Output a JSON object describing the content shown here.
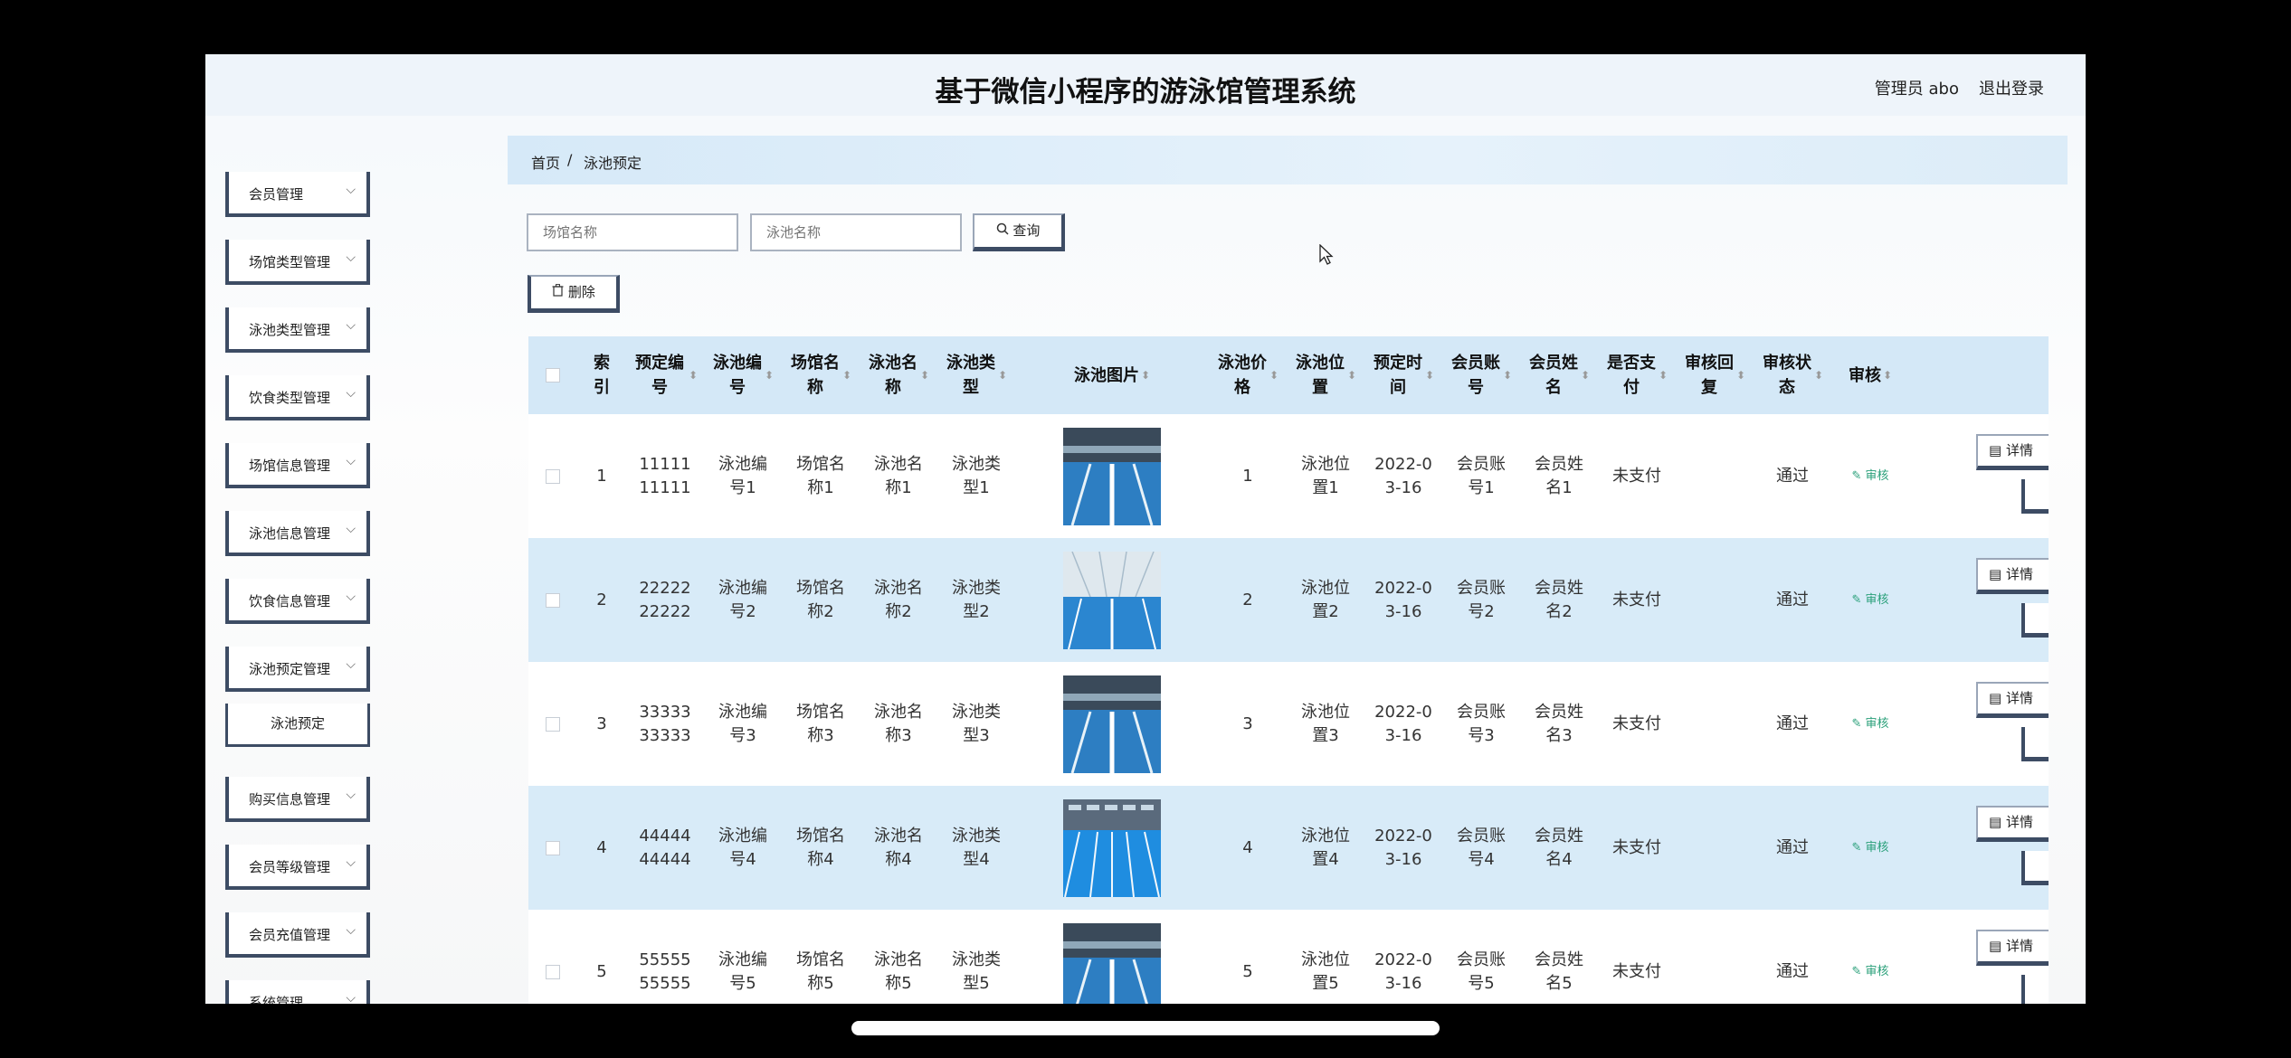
{
  "header": {
    "title": "基于微信小程序的游泳馆管理系统",
    "admin": "管理员 abo",
    "logout": "退出登录"
  },
  "sidebar": {
    "items": [
      {
        "label": "会员管理"
      },
      {
        "label": "场馆类型管理"
      },
      {
        "label": "泳池类型管理"
      },
      {
        "label": "饮食类型管理"
      },
      {
        "label": "场馆信息管理"
      },
      {
        "label": "泳池信息管理"
      },
      {
        "label": "饮食信息管理"
      },
      {
        "label": "泳池预定管理"
      },
      {
        "label": "购买信息管理"
      },
      {
        "label": "会员等级管理"
      },
      {
        "label": "会员充值管理"
      },
      {
        "label": "系统管理"
      }
    ],
    "subitem": {
      "label": "泳池预定"
    }
  },
  "breadcrumb": {
    "home": "首页",
    "sep": "/",
    "current": "泳池预定"
  },
  "search": {
    "venue_placeholder": "场馆名称",
    "pool_placeholder": "泳池名称",
    "query_label": "查询"
  },
  "toolbar": {
    "delete_label": "删除"
  },
  "table": {
    "headers": {
      "index": "索引",
      "booking_no": "预定编号",
      "pool_no": "泳池编号",
      "venue_name": "场馆名称",
      "pool_name": "泳池名称",
      "pool_type": "泳池类型",
      "pool_image": "泳池图片",
      "price": "泳池价格",
      "location": "泳池位置",
      "booking_time": "预定时间",
      "member_account": "会员账号",
      "member_name": "会员姓名",
      "paid": "是否支付",
      "audit_reply": "审核回复",
      "audit_status": "审核状态",
      "audit": "审核"
    },
    "rows": [
      {
        "index": "1",
        "booking_no": "1111111111",
        "pool_no": "泳池编号1",
        "venue_name": "场馆名称1",
        "pool_name": "泳池名称1",
        "pool_type": "泳池类型1",
        "price": "1",
        "location": "泳池位置1",
        "booking_time": "2022-03-16",
        "member_account": "会员账号1",
        "member_name": "会员姓名1",
        "paid": "未支付",
        "audit_reply": "",
        "audit_status": "通过",
        "audit_link": "审核",
        "detail": "详情"
      },
      {
        "index": "2",
        "booking_no": "2222222222",
        "pool_no": "泳池编号2",
        "venue_name": "场馆名称2",
        "pool_name": "泳池名称2",
        "pool_type": "泳池类型2",
        "price": "2",
        "location": "泳池位置2",
        "booking_time": "2022-03-16",
        "member_account": "会员账号2",
        "member_name": "会员姓名2",
        "paid": "未支付",
        "audit_reply": "",
        "audit_status": "通过",
        "audit_link": "审核",
        "detail": "详情"
      },
      {
        "index": "3",
        "booking_no": "3333333333",
        "pool_no": "泳池编号3",
        "venue_name": "场馆名称3",
        "pool_name": "泳池名称3",
        "pool_type": "泳池类型3",
        "price": "3",
        "location": "泳池位置3",
        "booking_time": "2022-03-16",
        "member_account": "会员账号3",
        "member_name": "会员姓名3",
        "paid": "未支付",
        "audit_reply": "",
        "audit_status": "通过",
        "audit_link": "审核",
        "detail": "详情"
      },
      {
        "index": "4",
        "booking_no": "4444444444",
        "pool_no": "泳池编号4",
        "venue_name": "场馆名称4",
        "pool_name": "泳池名称4",
        "pool_type": "泳池类型4",
        "price": "4",
        "location": "泳池位置4",
        "booking_time": "2022-03-16",
        "member_account": "会员账号4",
        "member_name": "会员姓名4",
        "paid": "未支付",
        "audit_reply": "",
        "audit_status": "通过",
        "audit_link": "审核",
        "detail": "详情"
      },
      {
        "index": "5",
        "booking_no": "5555555555",
        "pool_no": "泳池编号5",
        "venue_name": "场馆名称5",
        "pool_name": "泳池名称5",
        "pool_type": "泳池类型5",
        "price": "5",
        "location": "泳池位置5",
        "booking_time": "2022-03-16",
        "member_account": "会员账号5",
        "member_name": "会员姓名5",
        "paid": "未支付",
        "audit_reply": "",
        "audit_status": "通过",
        "audit_link": "审核",
        "detail": "详情"
      }
    ]
  },
  "icons": {
    "chevron": "chevron-down-icon",
    "search": "search-icon",
    "trash": "trash-icon",
    "edit": "edit-icon",
    "detail": "document-icon"
  },
  "colors": {
    "header_bg": "#eef4fa",
    "table_header_bg": "#d4e8f7",
    "row_alt_bg": "#d8ebf8",
    "button_border": "#3d4c64",
    "audit_link": "#2aa07a"
  }
}
